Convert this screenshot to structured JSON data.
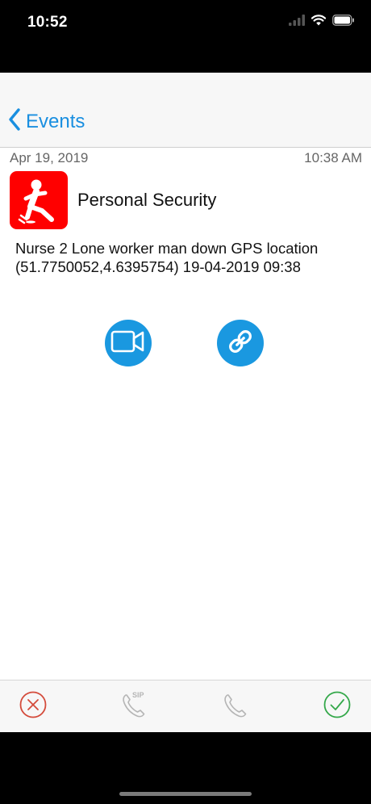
{
  "status_bar": {
    "time": "10:52"
  },
  "nav": {
    "back_label": "Events"
  },
  "event": {
    "date": "Apr 19, 2019",
    "time": "10:38 AM",
    "title": "Personal Security",
    "description": "Nurse 2 Lone worker man down GPS location (51.7750052,4.6395754) 19-04-2019 09:38",
    "icon": "man-down-icon",
    "icon_color": "#ff0000"
  },
  "actions": [
    {
      "icon": "video-camera-icon",
      "color": "#1a98e0"
    },
    {
      "icon": "link-icon",
      "color": "#1a98e0"
    }
  ],
  "tab_bar": {
    "reject": {
      "icon": "cancel-circle-icon",
      "color": "#d44b3b"
    },
    "sip_call": {
      "icon": "phone-icon",
      "label": "SIP",
      "color": "#b5b5b5"
    },
    "call": {
      "icon": "phone-icon",
      "color": "#b5b5b5"
    },
    "accept": {
      "icon": "check-circle-icon",
      "color": "#34a84a"
    }
  }
}
